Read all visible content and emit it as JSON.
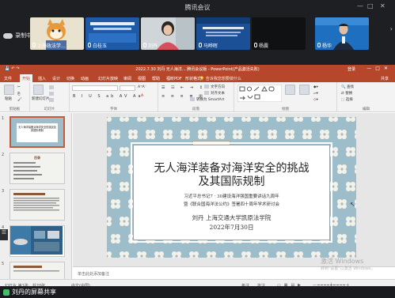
{
  "meeting": {
    "title": "腾讯会议",
    "record_label": "录制中",
    "participants": [
      {
        "name": "上海政法学..."
      },
      {
        "name": "白桂玉"
      },
      {
        "name": "刘丹"
      },
      {
        "name": "马晔晖"
      },
      {
        "name": "杨震"
      },
      {
        "name": "杨华"
      }
    ],
    "share_label": "刘丹的屏幕共享"
  },
  "ppt": {
    "window_title": "2022.7.30 刘丹 无人海洋... 腾讯会议版 - PowerPoint(产品激活失败)",
    "sign_in": "登录",
    "tabs": [
      "文件",
      "开始",
      "插入",
      "设计",
      "切换",
      "动画",
      "幻灯片放映",
      "审阅",
      "视图",
      "帮助",
      "福昕PDF",
      "形状格式"
    ],
    "active_tab": "开始",
    "tell_me": "告诉我您想要做什么",
    "share": "共享",
    "ribbon": {
      "paste": "粘贴",
      "new_slide": "新建幻灯片",
      "group_clipboard": "剪贴板",
      "group_slides": "幻灯片",
      "group_font": "字体",
      "group_paragraph": "段落",
      "group_drawing": "绘图",
      "group_editing": "编辑",
      "find": "查找",
      "replace": "替换",
      "select": "选择",
      "text_direction": "文字方向",
      "align_text": "对齐文本",
      "convert_smartart": "转换为 SmartArt"
    },
    "thumbnails": [
      {
        "num": "1",
        "title": "无人海洋装备对海洋安全的挑战及其国际规制"
      },
      {
        "num": "2",
        "title": "目录"
      },
      {
        "num": "3",
        "title": ""
      },
      {
        "num": "4",
        "title": ""
      },
      {
        "num": "5",
        "title": ""
      }
    ],
    "slide": {
      "title_line1": "无人海洋装备对海洋安全的挑战",
      "title_line2": "及其国际规制",
      "subtitle_line1": "习近平总书记7 · 30建设海洋强国重要讲话九周年",
      "subtitle_line2": "暨《联合国海洋法公约》签署四十周年学术研讨会",
      "author": "刘丹 上海交通大学凯原法学院",
      "date": "2022年7月30日"
    },
    "notes_placeholder": "单击此处添加备注",
    "status": {
      "slide_count": "幻灯片 第1张，共20张",
      "language": "中文(中国)",
      "notes": "备注",
      "comments": "批注"
    },
    "watermark": {
      "line1": "激活 Windows",
      "line2": "转到\"设置\"以激活 Windows。"
    }
  },
  "colors": {
    "ppt_accent": "#b7472a",
    "slide_pattern_bg": "#9ebdca",
    "share_indicator": "#3fbf6b"
  }
}
